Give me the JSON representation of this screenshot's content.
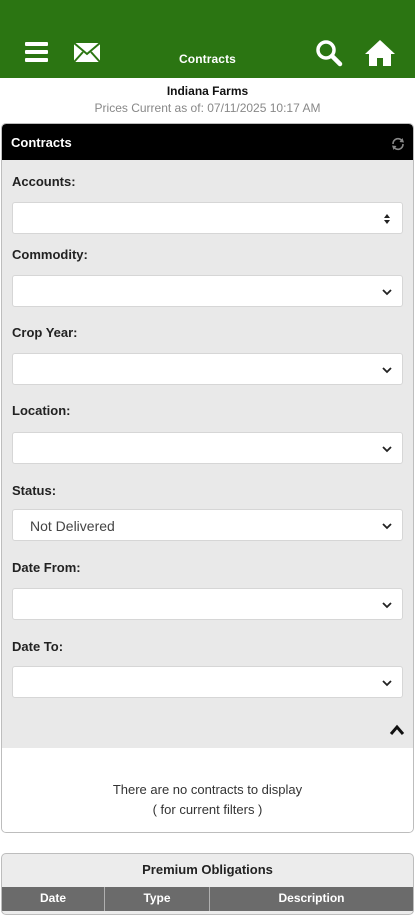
{
  "header": {
    "title": "Contracts",
    "menu_icon": "menu-icon",
    "mail_icon": "mail-icon",
    "search_icon": "search-icon",
    "home_icon": "home-icon",
    "background_color": "#2b7512"
  },
  "farm_name": "Indiana Farms",
  "prices_as_of": "Prices Current as of: 07/11/2025 10:17 AM",
  "contracts_panel": {
    "title": "Contracts",
    "refresh_icon": "refresh-icon",
    "filters": {
      "accounts": {
        "label": "Accounts:",
        "value": ""
      },
      "commodity": {
        "label": "Commodity:",
        "value": ""
      },
      "crop_year": {
        "label": "Crop Year:",
        "value": ""
      },
      "location": {
        "label": "Location:",
        "value": ""
      },
      "status": {
        "label": "Status:",
        "value": "Not Delivered"
      },
      "date_from": {
        "label": "Date From:",
        "value": ""
      },
      "date_to": {
        "label": "Date To:",
        "value": ""
      }
    },
    "empty_message_line1": "There are no contracts to display",
    "empty_message_line2": "( for current filters )"
  },
  "premium_panel": {
    "title": "Premium Obligations",
    "columns": [
      "Date",
      "Type",
      "Description"
    ]
  }
}
